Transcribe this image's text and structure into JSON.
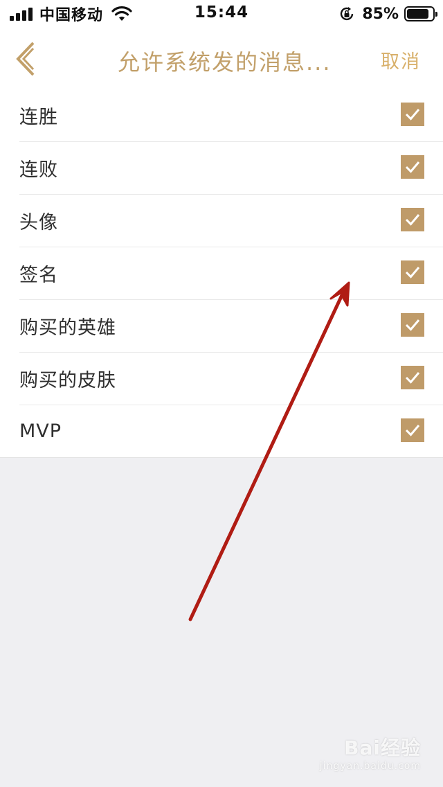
{
  "status_bar": {
    "carrier": "中国移动",
    "time": "15:44",
    "battery_percent": "85%",
    "battery_level": 0.85,
    "icons": [
      "signal-icon",
      "wifi-icon",
      "rotation-lock-icon",
      "battery-icon"
    ]
  },
  "nav": {
    "title": "允许系统发的消息...",
    "cancel_label": "取消",
    "back_icon": "chevron-left-icon"
  },
  "list": {
    "items": [
      {
        "label": "连胜",
        "checked": true
      },
      {
        "label": "连败",
        "checked": true
      },
      {
        "label": "头像",
        "checked": true
      },
      {
        "label": "签名",
        "checked": true
      },
      {
        "label": "购买的英雄",
        "checked": true
      },
      {
        "label": "购买的皮肤",
        "checked": true
      },
      {
        "label": "MVP",
        "checked": true
      }
    ]
  },
  "watermark": {
    "logo": "Bai经验",
    "url": "jingyan.baidu.com"
  },
  "colors": {
    "accent": "#c2a06a",
    "checkbox": "#bf9b69",
    "annotation_arrow": "#b01c14",
    "background": "#efeff2"
  }
}
